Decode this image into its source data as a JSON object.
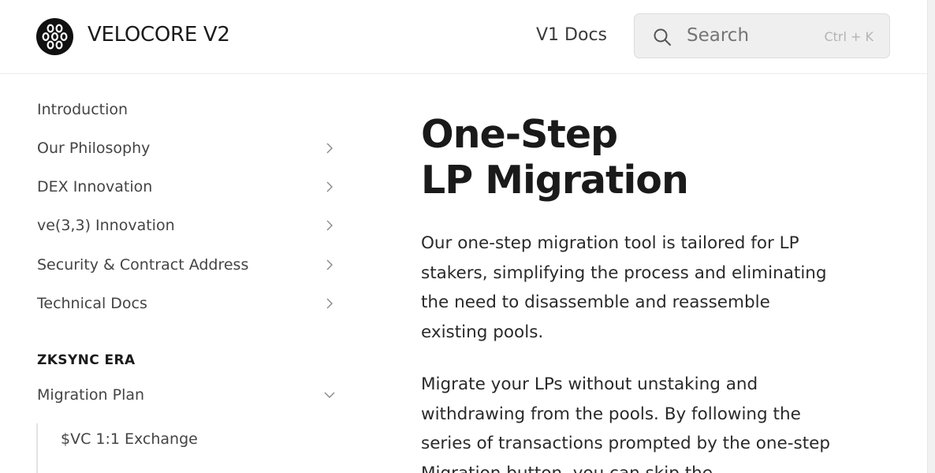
{
  "header": {
    "brand": "VELOCORE V2",
    "v1_docs": "V1 Docs",
    "search_placeholder": "Search",
    "search_shortcut": "Ctrl + K"
  },
  "sidebar": {
    "items": [
      {
        "label": "Introduction",
        "has_chevron": false
      },
      {
        "label": "Our Philosophy",
        "has_chevron": true
      },
      {
        "label": "DEX Innovation",
        "has_chevron": true
      },
      {
        "label": "ve(3,3) Innovation",
        "has_chevron": true
      },
      {
        "label": "Security & Contract Address",
        "has_chevron": true
      },
      {
        "label": "Technical Docs",
        "has_chevron": true
      }
    ],
    "section_title": "ZKSYNC ERA",
    "section_items": [
      {
        "label": "Migration Plan",
        "expanded": true
      }
    ],
    "sub_items": [
      {
        "label": "$VC 1:1 Exchange"
      }
    ]
  },
  "main": {
    "title_line1": "One-Step",
    "title_line2": "LP Migration",
    "paragraphs": [
      "Our one-step migration tool is tailored for LP stakers, simplifying the process and eliminating the need to disassemble and reassemble existing pools.",
      "Migrate your LPs without unstaking and withdrawing from the pools. By following the series of transactions prompted by the one-step Migration button, you can skip the"
    ]
  }
}
